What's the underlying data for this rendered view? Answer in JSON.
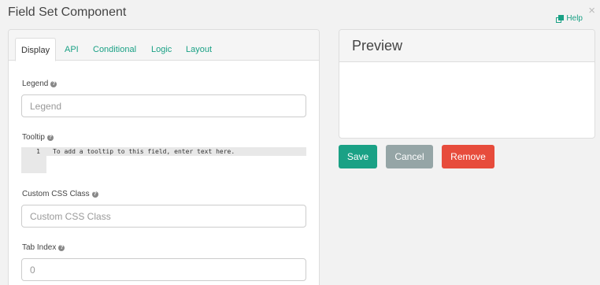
{
  "dialog": {
    "title": "Field Set Component",
    "help_label": "Help",
    "close_glyph": "×"
  },
  "tabs": [
    {
      "label": "Display",
      "active": true
    },
    {
      "label": "API",
      "active": false
    },
    {
      "label": "Conditional",
      "active": false
    },
    {
      "label": "Logic",
      "active": false
    },
    {
      "label": "Layout",
      "active": false
    }
  ],
  "form": {
    "legend": {
      "label": "Legend",
      "placeholder": "Legend",
      "value": ""
    },
    "tooltip": {
      "label": "Tooltip",
      "line_number": "1",
      "placeholder_text": "To add a tooltip to this field, enter text here."
    },
    "custom_css": {
      "label": "Custom CSS Class",
      "placeholder": "Custom CSS Class",
      "value": ""
    },
    "tab_index": {
      "label": "Tab Index",
      "placeholder": "0",
      "value": ""
    }
  },
  "preview": {
    "title": "Preview"
  },
  "actions": {
    "save_label": "Save",
    "cancel_label": "Cancel",
    "remove_label": "Remove"
  },
  "colors": {
    "accent": "#1aa185",
    "cancel": "#95a5a6",
    "danger": "#e74c3c"
  }
}
